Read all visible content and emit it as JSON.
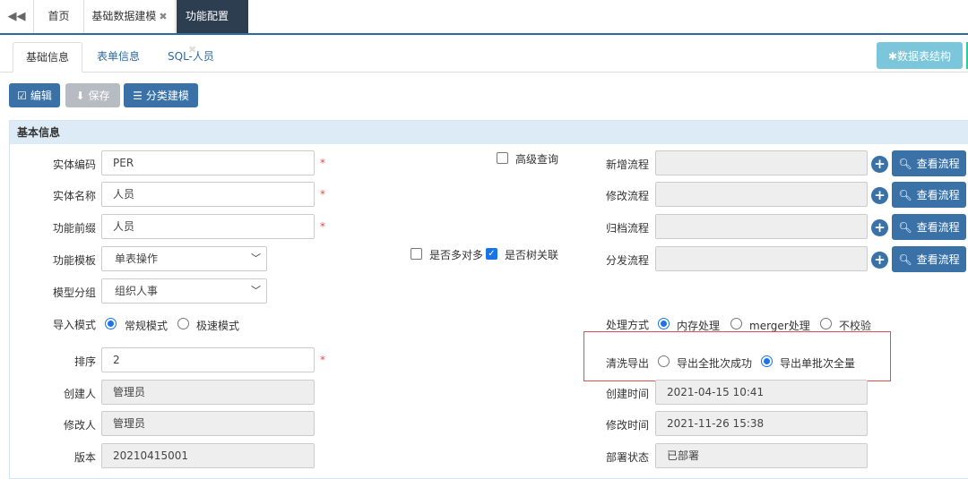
{
  "top_tabs": [
    {
      "label": "首页"
    },
    {
      "label": "基础数据建模",
      "close": "✖"
    },
    {
      "label": "功能配置",
      "close": "✖"
    }
  ],
  "sub_tabs": [
    "基础信息",
    "表单信息",
    "SQL-人员"
  ],
  "struct_button": "✱数据表结构",
  "toolbar": {
    "edit": "编辑",
    "save": "保存",
    "classify": "分类建模"
  },
  "panel_title": "基本信息",
  "left_form": {
    "entity_code": {
      "label": "实体编码",
      "value": "PER"
    },
    "entity_name": {
      "label": "实体名称",
      "value": "人员"
    },
    "func_prefix": {
      "label": "功能前缀",
      "value": "人员"
    },
    "func_template": {
      "label": "功能模板",
      "value": "单表操作"
    },
    "model_group": {
      "label": "模型分组",
      "value": "组织人事"
    },
    "import_mode": {
      "label": "导入模式",
      "options": [
        "常规模式",
        "极速模式"
      ],
      "selected": "常规模式"
    },
    "sort": {
      "label": "排序",
      "value": "2"
    },
    "creator": {
      "label": "创建人",
      "value": "管理员"
    },
    "modifier": {
      "label": "修改人",
      "value": "管理员"
    },
    "version": {
      "label": "版本",
      "value": "20210415001"
    },
    "required_mark": "*"
  },
  "middle": {
    "advanced_query": {
      "label": "高级查询",
      "checked": false
    },
    "many_to_many": {
      "label": "是否多对多",
      "checked": false
    },
    "tree_relation": {
      "label": "是否树关联",
      "checked": true
    }
  },
  "right_form": {
    "flows": [
      {
        "label": "新增流程",
        "button": "查看流程"
      },
      {
        "label": "修改流程",
        "button": "查看流程"
      },
      {
        "label": "归档流程",
        "button": "查看流程"
      },
      {
        "label": "分发流程",
        "button": "查看流程"
      }
    ],
    "process_mode": {
      "label": "处理方式",
      "options": [
        "内存处理",
        "merger处理",
        "不校验"
      ],
      "selected": "内存处理"
    },
    "clean_export": {
      "label": "清洗导出",
      "options": [
        "导出全批次成功",
        "导出单批次全量"
      ],
      "selected": "导出单批次全量"
    },
    "create_time": {
      "label": "创建时间",
      "value": "2021-04-15 10:41"
    },
    "modify_time": {
      "label": "修改时间",
      "value": "2021-11-26 15:38"
    },
    "deploy_status": {
      "label": "部署状态",
      "value": "已部署"
    }
  },
  "colors": {
    "primary": "#3a72a8",
    "header_bg": "#2c3e50",
    "panel_head": "#ddebf6",
    "highlight": "#e05050"
  }
}
